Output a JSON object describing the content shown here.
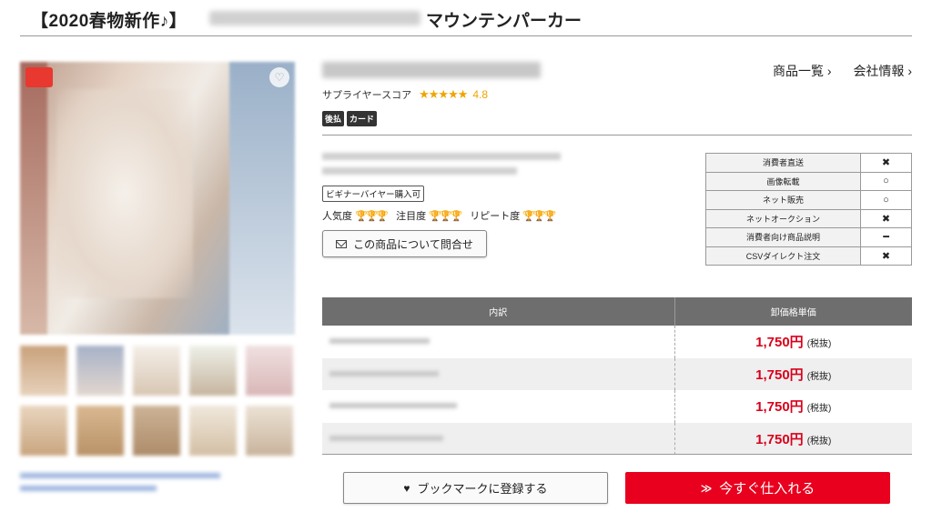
{
  "title": {
    "prefix": "【2020春物新作♪】",
    "suffix": "マウンテンパーカー"
  },
  "supplier": {
    "score_label": "サプライヤースコア",
    "stars": "★★★★★",
    "score": "4.8",
    "tags": [
      "後払",
      "カード"
    ],
    "links": [
      "商品一覧 ›",
      "会社情報 ›"
    ]
  },
  "product": {
    "beginner_badge": "ビギナーバイヤー購入可",
    "ratings": [
      {
        "label": "人気度",
        "filled": 2,
        "total": 3
      },
      {
        "label": "注目度",
        "filled": 3,
        "total": 3
      },
      {
        "label": "リピート度",
        "filled": 3,
        "total": 3
      }
    ],
    "inquiry_label": "この商品について問合せ"
  },
  "permissions": [
    {
      "label": "消費者直送",
      "value": "✖"
    },
    {
      "label": "画像転載",
      "value": "○"
    },
    {
      "label": "ネット販売",
      "value": "○"
    },
    {
      "label": "ネットオークション",
      "value": "✖"
    },
    {
      "label": "消費者向け商品説明",
      "value": "━"
    },
    {
      "label": "CSVダイレクト注文",
      "value": "✖"
    }
  ],
  "price_table": {
    "headers": [
      "内訳",
      "卸価格単価"
    ],
    "rows": [
      {
        "price": "1,750円",
        "tax": "(税抜)"
      },
      {
        "price": "1,750円",
        "tax": "(税抜)"
      },
      {
        "price": "1,750円",
        "tax": "(税抜)"
      },
      {
        "price": "1,750円",
        "tax": "(税抜)"
      }
    ]
  },
  "actions": {
    "bookmark_label": "ブックマークに登録する",
    "buy_label": "今すぐ仕入れる"
  },
  "colors": {
    "accent_red": "#e8001e",
    "price_red": "#d9001b",
    "star_gold": "#f0a400"
  }
}
